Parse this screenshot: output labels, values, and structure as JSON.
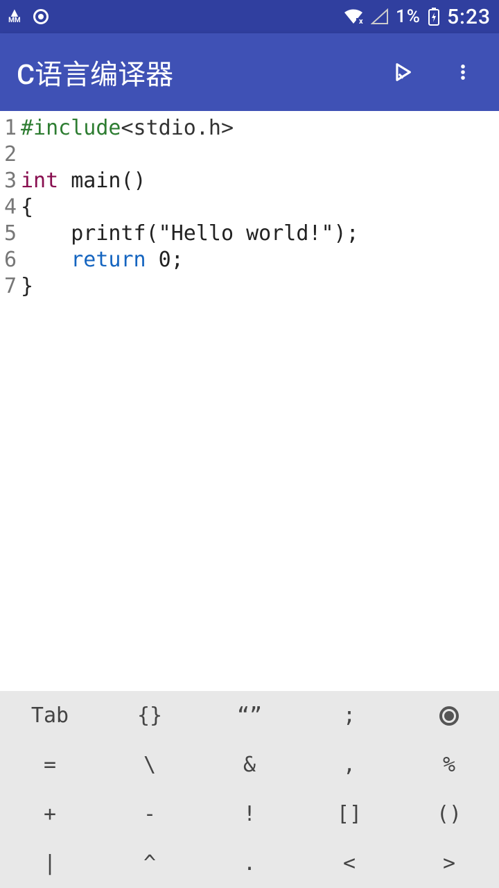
{
  "status": {
    "mm_label": "MM",
    "battery_text": "1%",
    "time": "5:23"
  },
  "appbar": {
    "title": "C语言编译器"
  },
  "code": {
    "lines": [
      {
        "n": "1",
        "tokens": [
          {
            "cls": "tok-pre",
            "t": "#include"
          },
          {
            "cls": "tok-inc",
            "t": "<stdio.h>"
          }
        ]
      },
      {
        "n": "2",
        "tokens": [
          {
            "cls": "tok-txt",
            "t": ""
          }
        ]
      },
      {
        "n": "3",
        "tokens": [
          {
            "cls": "tok-kw",
            "t": "int"
          },
          {
            "cls": "tok-txt",
            "t": " main()"
          }
        ]
      },
      {
        "n": "4",
        "tokens": [
          {
            "cls": "tok-txt",
            "t": "{"
          }
        ]
      },
      {
        "n": "5",
        "tokens": [
          {
            "cls": "tok-txt",
            "t": "    printf(\"Hello world!\");"
          }
        ]
      },
      {
        "n": "6",
        "tokens": [
          {
            "cls": "tok-txt",
            "t": "    "
          },
          {
            "cls": "tok-kw2",
            "t": "return"
          },
          {
            "cls": "tok-txt",
            "t": " 0;"
          }
        ]
      },
      {
        "n": "7",
        "tokens": [
          {
            "cls": "tok-txt",
            "t": "}"
          }
        ]
      }
    ]
  },
  "symbar": {
    "keys": [
      "Tab",
      "{}",
      "“”",
      ";",
      "●",
      "=",
      "\\",
      "&",
      ",",
      "%",
      "+",
      "-",
      "!",
      "[]",
      "()",
      "|",
      "^",
      ".",
      "<",
      ">"
    ]
  }
}
